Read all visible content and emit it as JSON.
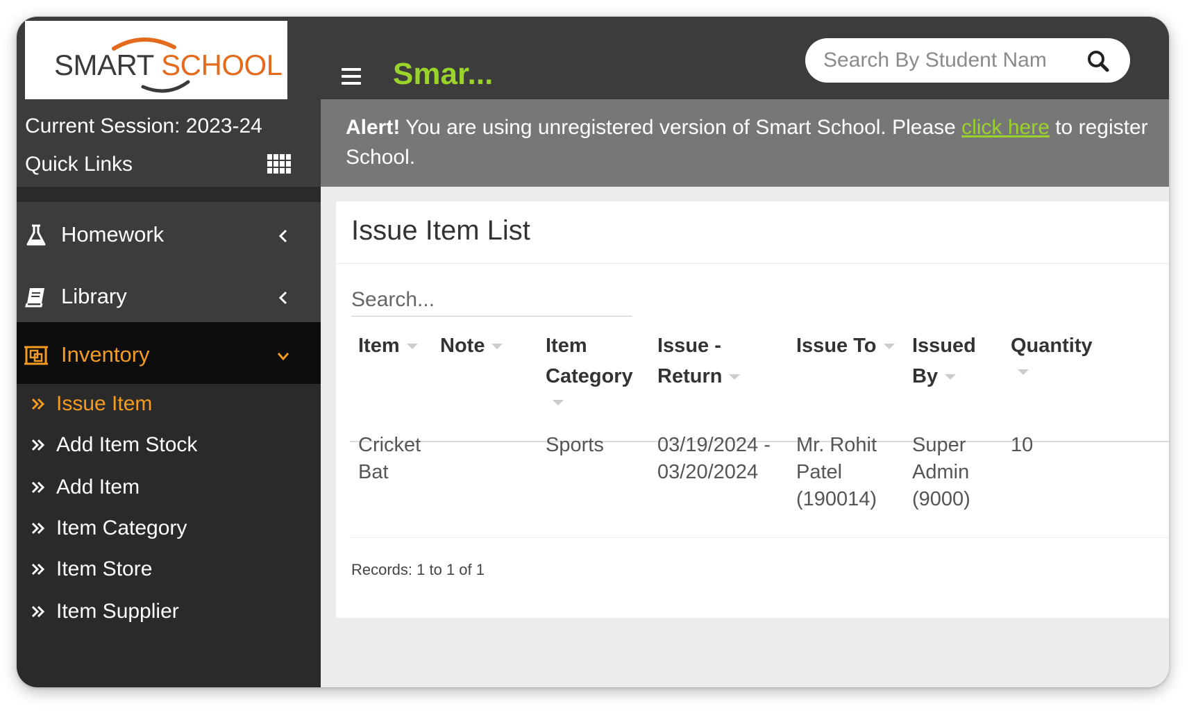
{
  "logo": {
    "word1": "SMART",
    "word2": "SCHOOL"
  },
  "header": {
    "brand_title": "Smar...",
    "search_placeholder": "Search By Student Nam"
  },
  "sidebar": {
    "session": "Current Session: 2023-24",
    "quick_links": "Quick Links",
    "nav": [
      {
        "label": "Homework",
        "icon": "flask-icon",
        "expanded": false
      },
      {
        "label": "Library",
        "icon": "book-icon",
        "expanded": false
      },
      {
        "label": "Inventory",
        "icon": "inventory-icon",
        "expanded": true
      }
    ],
    "submenu": [
      {
        "label": "Issue Item",
        "active": true
      },
      {
        "label": "Add Item Stock",
        "active": false
      },
      {
        "label": "Add Item",
        "active": false
      },
      {
        "label": "Item Category",
        "active": false
      },
      {
        "label": "Item Store",
        "active": false
      },
      {
        "label": "Item Supplier",
        "active": false
      }
    ]
  },
  "alert": {
    "prefix": "Alert!",
    "text_before": " You are using unregistered version of Smart School. Please ",
    "link": "click here",
    "text_after": " to register",
    "line2": "School."
  },
  "card": {
    "title": "Issue Item List",
    "search_placeholder": "Search...",
    "columns": [
      "Item",
      "Note",
      "Item Category",
      "Issue - Return",
      "Issue To",
      "Issued By",
      "Quantity"
    ],
    "rows": [
      {
        "item": "Cricket Bat",
        "note": "",
        "category": "Sports",
        "issue_return": "03/19/2024 - 03/20/2024",
        "issue_to": "Mr. Rohit Patel (190014)",
        "issued_by": "Super Admin (9000)",
        "quantity": "10"
      }
    ],
    "records": "Records: 1 to 1 of 1"
  },
  "colors": {
    "header_bg": "#3c3c3c",
    "brand_green": "#9ad32a",
    "accent_orange": "#f39c21",
    "sidebar_bg": "#2a2a2a",
    "alert_bg": "#777777"
  }
}
